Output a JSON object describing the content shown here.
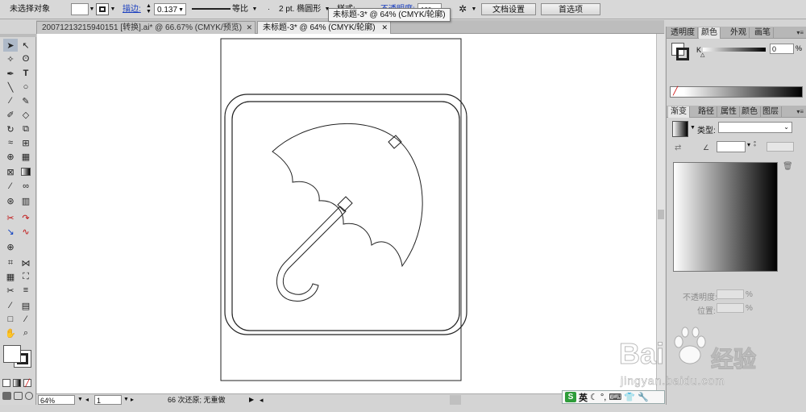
{
  "control_bar": {
    "selection_status": "未选择对象",
    "stroke_label": "描边:",
    "stroke_weight": "0.137",
    "profile_label": "等比",
    "brush_label": "2 pt. 椭圆形",
    "style_label": "样式:",
    "opacity_label": "不透明度:",
    "opacity_value": "100",
    "doc_setup_button": "文档设置",
    "preferences_button": "首选项"
  },
  "tooltip": "未标题-3* @ 64% (CMYK/轮廓)",
  "tabs": [
    {
      "label": "20071213215940151 [转换].ai* @ 66.67% (CMYK/预览)",
      "close": "✕"
    },
    {
      "label": "未标题-3* @ 64% (CMYK/轮廓)",
      "close": "✕"
    }
  ],
  "status_bar": {
    "zoom": "64%",
    "artboard": "1",
    "history": "66 次还原; 无重做"
  },
  "color_panel": {
    "tabs": [
      "透明度",
      "颜色",
      "外观",
      "画笔"
    ],
    "channel_label": "K",
    "channel_value": "0",
    "percent": "%"
  },
  "gradient_panel": {
    "tabs": [
      "渐变",
      "路径",
      "属性",
      "颜色",
      "图层"
    ],
    "type_label": "类型:",
    "opacity_label": "不透明度:",
    "position_label": "位置:",
    "percent": "%"
  },
  "watermark": {
    "brand": "Bai",
    "brand_cn": "经验",
    "url": "jingyan.baidu.com"
  },
  "ime": {
    "lang": "英"
  },
  "colors": {
    "accent_link": "#1a3fbf",
    "outline": "#222222"
  }
}
